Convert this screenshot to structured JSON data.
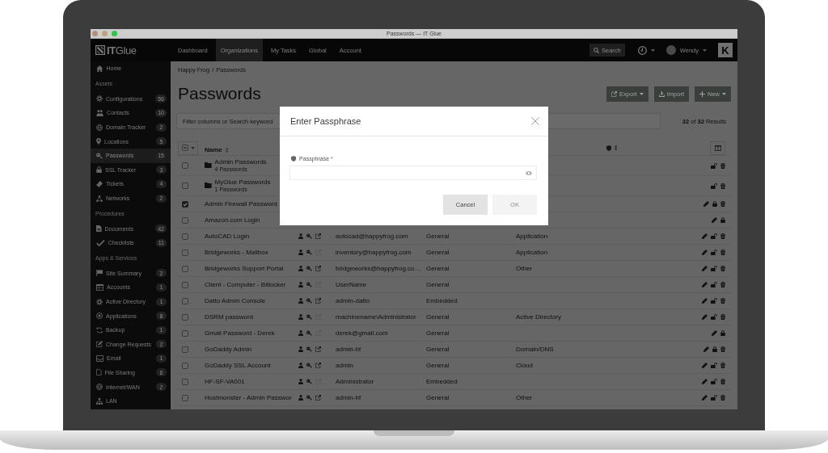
{
  "window": {
    "title": "Passwords — IT Glue"
  },
  "topnav": {
    "logo": "**IT**Glue",
    "items": [
      {
        "label": "Dashboard",
        "selected": false
      },
      {
        "label": "Organizations",
        "selected": true
      },
      {
        "label": "My Tasks",
        "selected": false
      },
      {
        "label": "Global",
        "selected": false
      },
      {
        "label": "Account",
        "selected": false
      }
    ],
    "search": "Search",
    "user": "Wendy",
    "corner_logo": "K"
  },
  "sidebar": {
    "items": [
      {
        "label": "Home",
        "selected": false
      }
    ],
    "sections": [
      {
        "title": "Assets",
        "items": [
          {
            "label": "Configurations",
            "count": "56",
            "selected": false
          },
          {
            "label": "Contacts",
            "count": "10",
            "selected": false
          },
          {
            "label": "Domain Tracker",
            "count": "2",
            "selected": false
          },
          {
            "label": "Locations",
            "count": "5",
            "selected": false
          },
          {
            "label": "Passwords",
            "count": "15",
            "selected": true
          },
          {
            "label": "SSL Tracker",
            "count": "3",
            "selected": false
          },
          {
            "label": "Tickets",
            "count": "4",
            "selected": false
          },
          {
            "label": "Networks",
            "count": "2",
            "selected": false
          }
        ]
      },
      {
        "title": "Procedures",
        "items": [
          {
            "label": "Documents",
            "count": "42",
            "selected": false
          },
          {
            "label": "Checklists",
            "count": "11",
            "selected": false
          }
        ]
      },
      {
        "title": "Apps & Services",
        "items": [
          {
            "label": "Site Summary",
            "count": "2",
            "selected": false
          },
          {
            "label": "Accounts",
            "count": "1",
            "selected": false
          },
          {
            "label": "Active Directory",
            "count": "1",
            "selected": false
          },
          {
            "label": "Applications",
            "count": "8",
            "selected": false
          },
          {
            "label": "Backup",
            "count": "1",
            "selected": false
          },
          {
            "label": "Change Requests",
            "count": "2",
            "selected": false
          },
          {
            "label": "Email",
            "count": "1",
            "selected": false
          },
          {
            "label": "File Sharing",
            "count": "6",
            "selected": false
          },
          {
            "label": "Internet/WAN",
            "count": "2",
            "selected": false
          },
          {
            "label": "LAN",
            "selected": false
          }
        ]
      }
    ]
  },
  "breadcrumb": {
    "items": [
      "Happy Frog",
      "Passwords"
    ],
    "separator": "/"
  },
  "page_title": "Passwords",
  "actions": [
    {
      "label": "Export",
      "kind": "export",
      "dropdown": true
    },
    {
      "label": "Import",
      "kind": "import",
      "dropdown": false
    },
    {
      "label": "New",
      "kind": "new",
      "dropdown": true
    }
  ],
  "filter": {
    "placeholder": "Filter columns or Search keyword",
    "results": "**32** of **32** Results"
  },
  "table": {
    "select_all": {
      "indeterminate": true
    },
    "columns": [
      {
        "label": "Name"
      }
    ],
    "folders": [
      {
        "name": "Admin Passwords",
        "count": "4 Passwords",
        "selected": false,
        "editable": false,
        "locked": false,
        "deletable": true
      },
      {
        "name": "MyGlue Passwords",
        "count": "1 Passwords",
        "selected": false,
        "editable": false,
        "locked": false,
        "deletable": true
      }
    ],
    "rows": [
      {
        "name": "Admin Firewall Password",
        "selected": true,
        "editable": true,
        "locked": true,
        "deletable": true
      },
      {
        "name": "Amazon.com Login",
        "selected": false,
        "editable": true,
        "locked": true,
        "deletable": false
      },
      {
        "name": "AutoCAD Login",
        "selected": false,
        "has_url": true,
        "username": "autocad@happyfrog.com",
        "type": "General",
        "category": "Application",
        "editable": true,
        "locked": false,
        "deletable": true
      },
      {
        "name": "Bridgeworks - Mailbox",
        "selected": false,
        "has_url": false,
        "username": "inventory@happyfrog.com",
        "type": "General",
        "category": "Application",
        "editable": true,
        "locked": false,
        "deletable": true
      },
      {
        "name": "Bridgeworks Support Portal",
        "selected": false,
        "has_url": true,
        "username": "bridgeworks@happyfrog.co…",
        "type": "General",
        "category": "Other",
        "editable": true,
        "locked": false,
        "deletable": true
      },
      {
        "name": "Client - Computer - Bitlocker",
        "selected": false,
        "has_url": false,
        "username": "UserName",
        "type": "General",
        "editable": true,
        "locked": false,
        "deletable": true
      },
      {
        "name": "Datto Admin Console",
        "selected": false,
        "has_url": true,
        "username": "admin-datto",
        "type": "Embedded",
        "editable": true,
        "locked": false,
        "deletable": true
      },
      {
        "name": "DSRM password",
        "selected": false,
        "has_url": false,
        "username": "machinename\\Administrator",
        "type": "General",
        "category": "Active Directory",
        "editable": true,
        "locked": false,
        "deletable": true
      },
      {
        "name": "Gmail Password - Derek",
        "selected": false,
        "has_url": false,
        "username": "derek@gmail.com",
        "type": "General",
        "editable": true,
        "locked": true,
        "deletable": false
      },
      {
        "name": "GoDaddy Admin",
        "selected": false,
        "has_url": true,
        "username": "admin-hf",
        "type": "General",
        "category": "Domain/DNS",
        "editable": true,
        "locked": true,
        "deletable": true
      },
      {
        "name": "GoDaddy SSL Account",
        "selected": false,
        "has_url": true,
        "username": "admin",
        "type": "General",
        "category": "Cloud",
        "editable": true,
        "locked": false,
        "deletable": true
      },
      {
        "name": "HF-SF-VA001",
        "selected": false,
        "has_url": false,
        "username": "Administrator",
        "type": "Embedded",
        "editable": true,
        "locked": false,
        "deletable": true
      },
      {
        "name": "Hostmonster - Admin Passwor",
        "selected": false,
        "has_url": true,
        "username": "admin-hf",
        "type": "General",
        "category": "Other",
        "editable": true,
        "locked": false,
        "deletable": true
      }
    ]
  },
  "modal": {
    "title": "Enter Passphrase",
    "field": {
      "label": "Passphrase",
      "required_mark": "*"
    },
    "buttons": [
      {
        "label": "Cancel",
        "kind": "cancel",
        "disabled": false
      },
      {
        "label": "OK",
        "kind": "confirm",
        "disabled": true
      }
    ]
  }
}
